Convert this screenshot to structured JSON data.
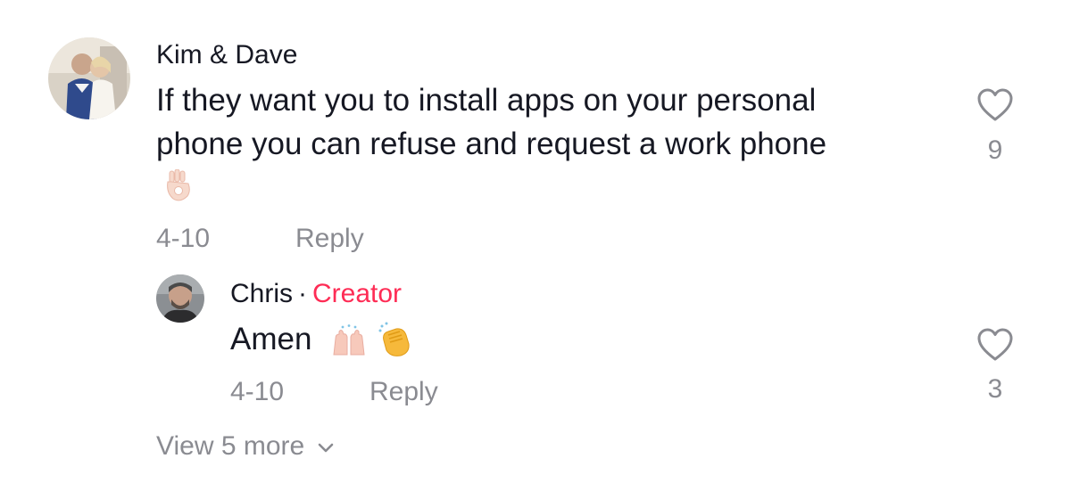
{
  "comments": [
    {
      "author": "Kim & Dave",
      "text_lines": [
        "If they want you to install apps on your personal",
        "phone you can refuse and request a work phone"
      ],
      "emoji_icon": "ok-hand-emoji",
      "date": "4-10",
      "reply_label": "Reply",
      "likes": "9"
    }
  ],
  "reply": {
    "author": "Chris",
    "separator": "·",
    "badge": "Creator",
    "text": "Amen",
    "emoji_icons": [
      "raising-hands-emoji",
      "clapping-hands-emoji"
    ],
    "date": "4-10",
    "reply_label": "Reply",
    "likes": "3"
  },
  "view_more": "View 5 more",
  "colors": {
    "text": "#161823",
    "muted": "#8a8b91",
    "creator": "#fe2c55"
  }
}
